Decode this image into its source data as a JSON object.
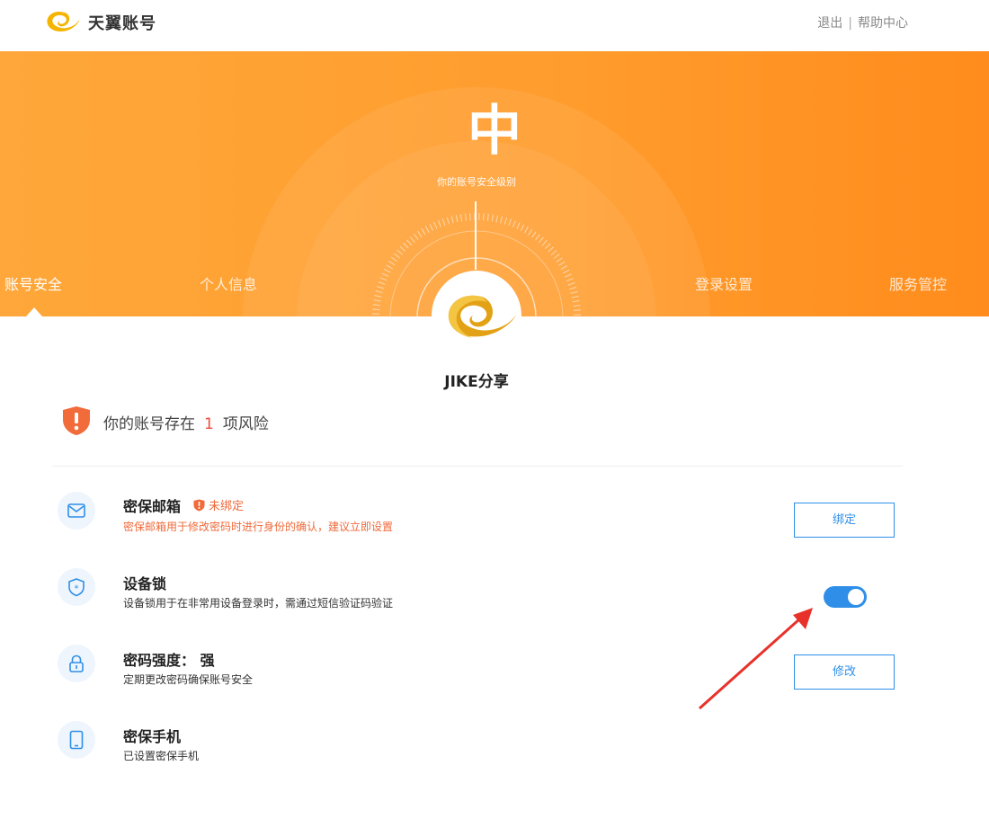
{
  "header": {
    "brand": "天翼账号",
    "logout": "退出",
    "separator": "|",
    "help": "帮助中心"
  },
  "banner": {
    "level": "中",
    "level_label": "你的账号安全级别",
    "nav": [
      "账号安全",
      "个人信息",
      "登录设置",
      "服务管控"
    ],
    "active_nav": "账号安全"
  },
  "user": {
    "name": "JIKE分享"
  },
  "risk": {
    "prefix": "你的账号存在",
    "count": "1",
    "suffix": "项风险"
  },
  "items": [
    {
      "title": "密保邮箱",
      "badge": "未绑定",
      "desc": "密保邮箱用于修改密码时进行身份的确认，建议立即设置",
      "action": "绑定",
      "icon": "mail-icon"
    },
    {
      "title": "设备锁",
      "desc": "设备锁用于在非常用设备登录时，需通过短信验证码验证",
      "toggle_on": true,
      "icon": "shield-star-icon"
    },
    {
      "title": "密码强度： 强",
      "desc": "定期更改密码确保账号安全",
      "action": "修改",
      "icon": "lock-icon"
    },
    {
      "title": "密保手机",
      "desc": "已设置密保手机",
      "icon": "phone-icon"
    }
  ],
  "colors": {
    "banner_orange": "#ff9d2e",
    "accent_blue": "#2f8fe8",
    "warning": "#f06a3a",
    "arrow_red": "#e8312a"
  }
}
